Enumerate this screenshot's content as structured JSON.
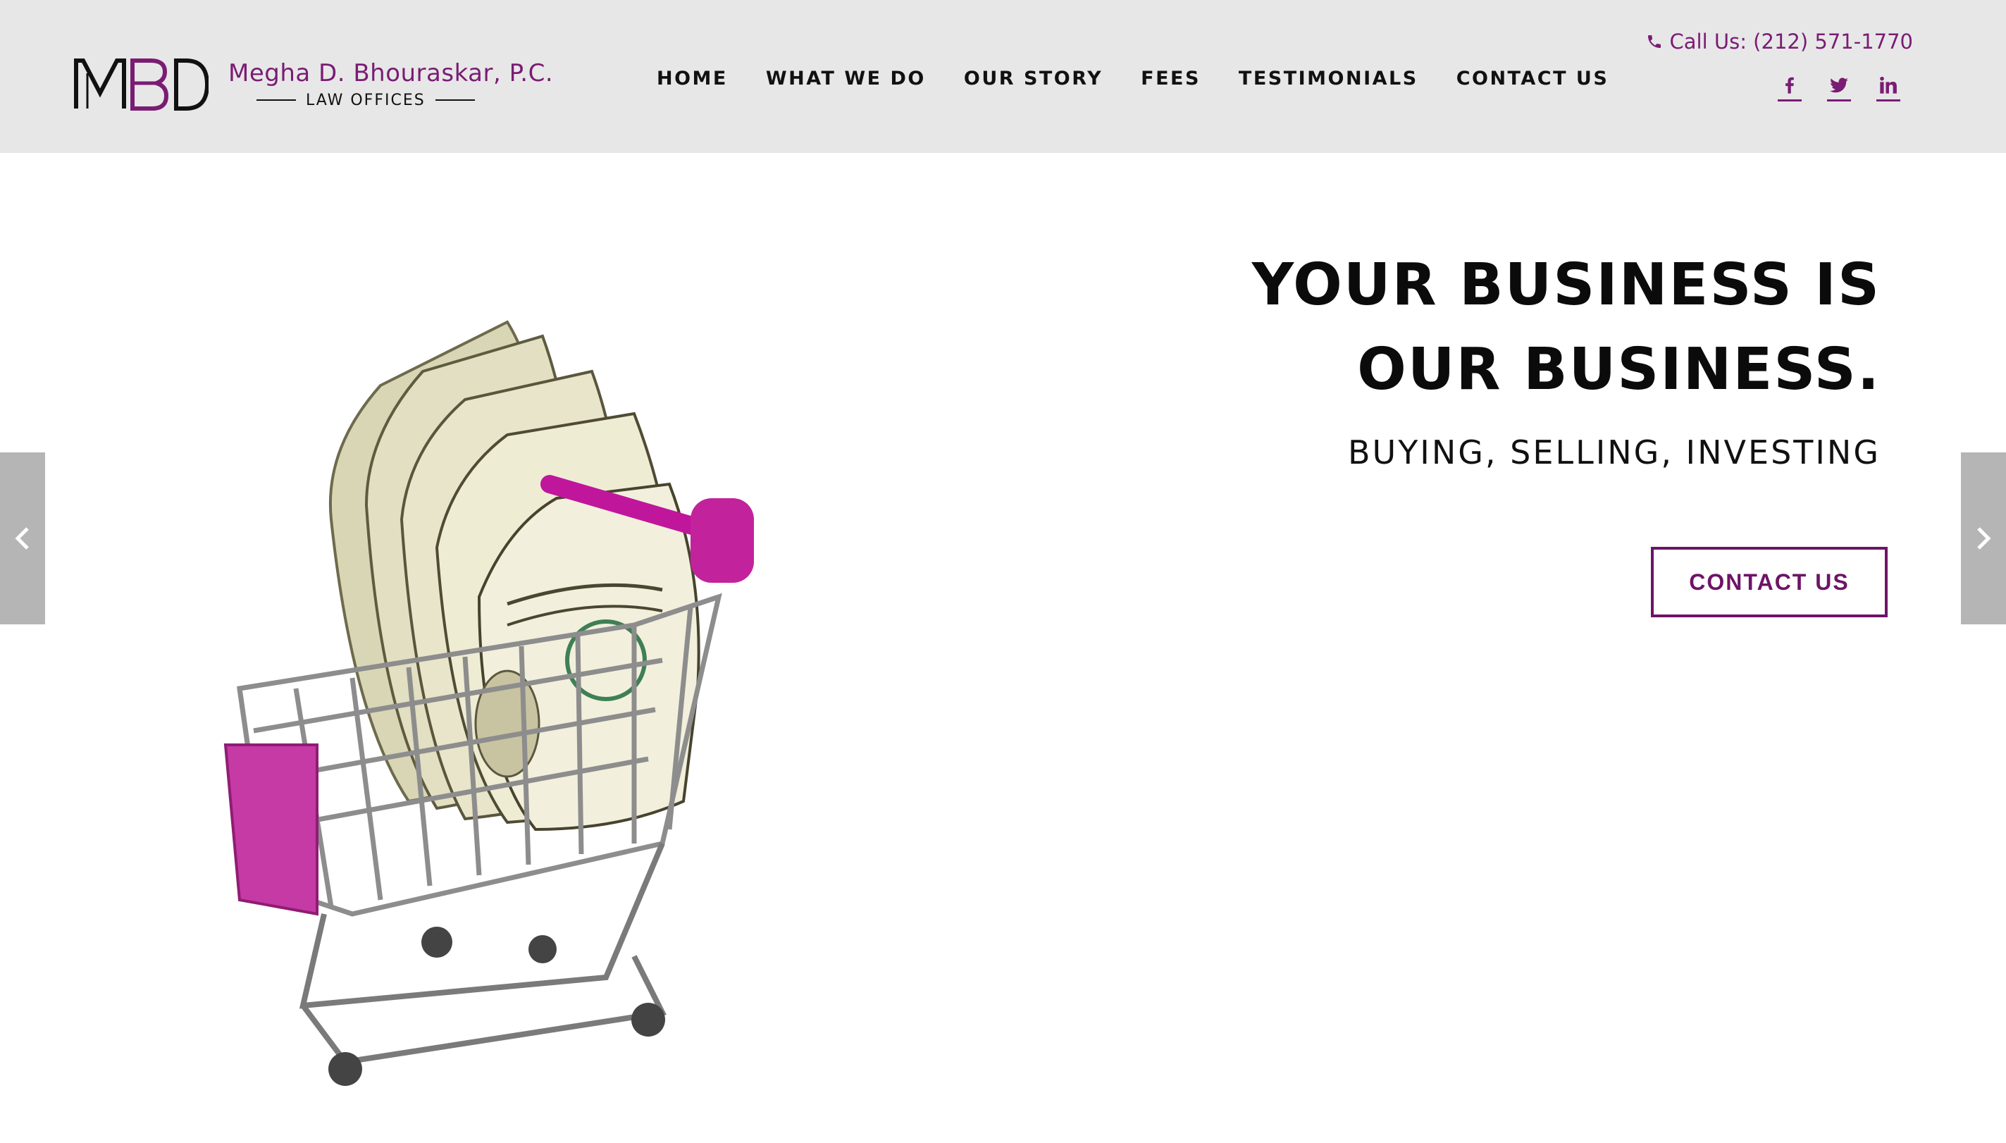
{
  "brand": {
    "monogram": "MBD",
    "name": "Megha D. Bhouraskar, P.C.",
    "sub": "LAW OFFICES",
    "accent": "#7a1c73"
  },
  "nav": {
    "items": [
      {
        "label": "HOME"
      },
      {
        "label": "WHAT WE DO"
      },
      {
        "label": "OUR STORY"
      },
      {
        "label": "FEES"
      },
      {
        "label": "TESTIMONIALS"
      },
      {
        "label": "CONTACT US"
      }
    ]
  },
  "contact": {
    "phone": "Call Us: (212) 571-1770",
    "phone_icon": "phone-icon"
  },
  "social": {
    "icons": [
      "facebook-icon",
      "twitter-icon",
      "linkedin-icon"
    ]
  },
  "hero": {
    "headline_line1": "YOUR BUSINESS IS",
    "headline_line2": "OUR BUSINESS.",
    "subheading": "BUYING, SELLING, INVESTING",
    "cta_label": "CONTACT US",
    "image": "shopping-cart-with-dollar-bills",
    "prev_icon": "chevron-left-icon",
    "next_icon": "chevron-right-icon"
  }
}
